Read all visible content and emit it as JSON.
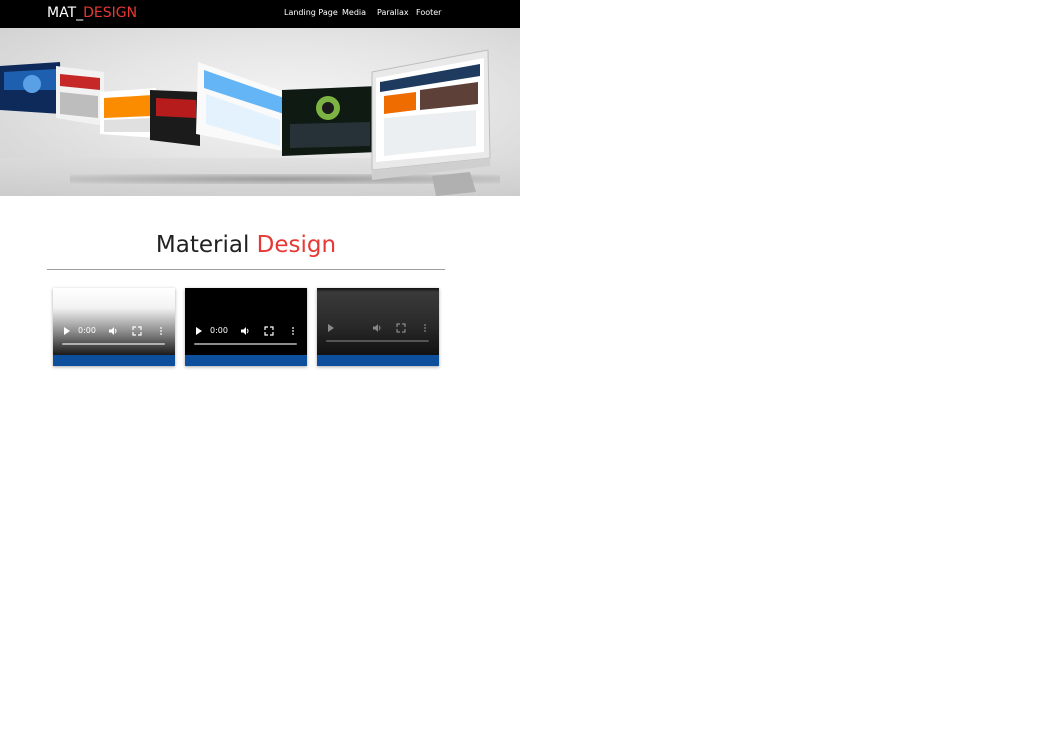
{
  "brand": {
    "part1": "MAT_",
    "part2": "DESIGN"
  },
  "nav": {
    "items": [
      {
        "label": "Landing Page"
      },
      {
        "label": "Media"
      },
      {
        "label": "Parallax"
      },
      {
        "label": "Footer"
      }
    ]
  },
  "hero": {
    "icon": "monitor-showcase-image"
  },
  "section": {
    "title_dark": "Material ",
    "title_red": "Design"
  },
  "videos": [
    {
      "time": "0:00",
      "progress": 0.0
    },
    {
      "time": "0:00",
      "progress": 0.0
    },
    {
      "time": "",
      "progress": 0.0
    }
  ],
  "colors": {
    "accent": "#e53935",
    "nav_bg": "#000000",
    "card_bar": "#0d4f9c"
  }
}
